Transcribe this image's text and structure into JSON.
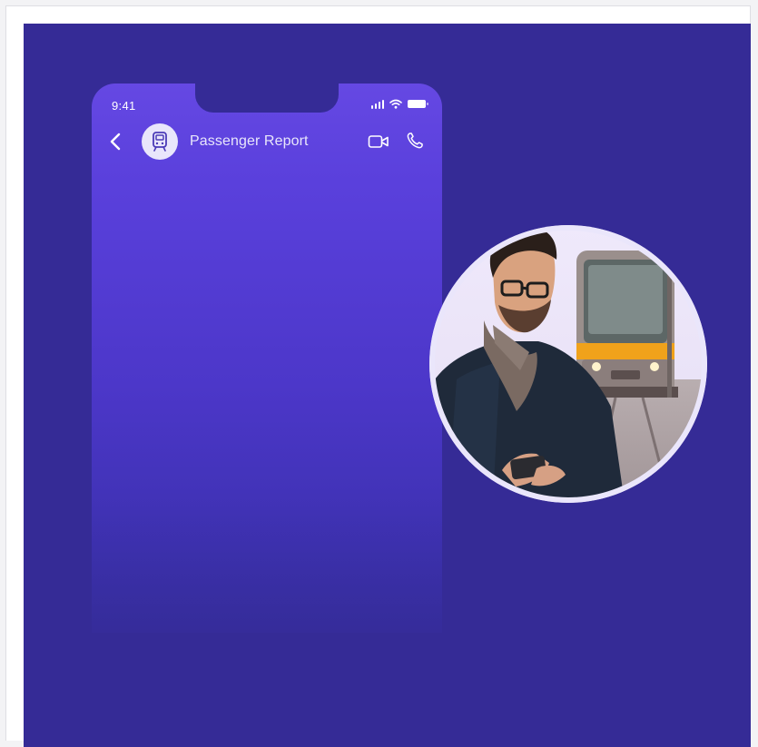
{
  "status_bar": {
    "time": "9:41"
  },
  "chat_header": {
    "title": "Passenger Report",
    "avatar_icon": "tram-icon",
    "back_icon": "chevron-left-icon",
    "video_icon": "video-camera-icon",
    "call_icon": "phone-icon"
  },
  "photo": {
    "subject": "man-using-phone-near-tram-photo"
  },
  "colors": {
    "background": "#352b96",
    "phone_top": "#6548e3",
    "phone_bottom": "#362d9e",
    "avatar_bg": "#e9e6fb",
    "tram_yellow": "#f0a21b"
  }
}
